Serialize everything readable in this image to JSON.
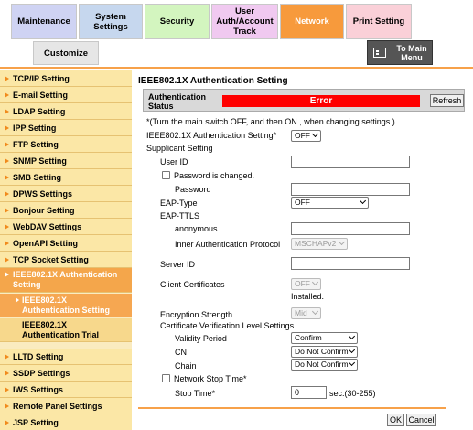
{
  "tabs": {
    "maintenance": "Maintenance",
    "system_settings": "System Settings",
    "security": "Security",
    "user_auth": "User Auth/Account Track",
    "network": "Network",
    "print_setting": "Print Setting",
    "customize": "Customize",
    "to_main_menu": "To Main Menu"
  },
  "sidebar": {
    "items": [
      "TCP/IP Setting",
      "E-mail Setting",
      "LDAP Setting",
      "IPP Setting",
      "FTP Setting",
      "SNMP Setting",
      "SMB Setting",
      "DPWS Settings",
      "Bonjour Setting",
      "WebDAV Settings",
      "OpenAPI Setting",
      "TCP Socket Setting",
      "IEEE802.1X Authentication Setting",
      "LLTD Setting",
      "SSDP Settings",
      "IWS Settings",
      "Remote Panel Settings",
      "JSP Setting"
    ],
    "subitems": [
      "IEEE802.1X Authentication Setting",
      "IEEE802.1X Authentication Trial"
    ]
  },
  "main": {
    "title": "IEEE802.1X Authentication Setting",
    "status_label": "Authentication Status",
    "status_value": "Error",
    "refresh": "Refresh",
    "note": "*(Turn the main switch OFF, and then ON , when changing settings.)",
    "ieee_label": "IEEE802.1X Authentication Setting*",
    "ieee_value": "OFF",
    "supplicant": "Supplicant Setting",
    "user_id": "User ID",
    "password_changed": "Password is changed.",
    "password": "Password",
    "eap_type": "EAP-Type",
    "eap_type_value": "OFF",
    "eap_ttls": "EAP-TTLS",
    "anonymous": "anonymous",
    "inner_auth": "Inner Authentication Protocol",
    "inner_auth_value": "MSCHAPv2",
    "server_id": "Server ID",
    "client_certs": "Client Certificates",
    "client_certs_value": "OFF",
    "installed": "Installed.",
    "encryption": "Encryption Strength",
    "encryption_value": "Mid",
    "cert_verify": "Certificate Verification Level Settings",
    "validity": "Validity Period",
    "validity_value": "Confirm",
    "cn": "CN",
    "cn_value": "Do Not Confirm",
    "chain": "Chain",
    "chain_value": "Do Not Confirm",
    "network_stop": "Network Stop Time*",
    "stop_time": "Stop Time*",
    "stop_time_value": "0",
    "stop_time_unit": "sec.(30-255)",
    "ok": "OK",
    "cancel": "Cancel"
  },
  "colors": {
    "network_tab": "#f79a3c",
    "sidebar_bg": "#fbe7a6",
    "error": "#ff0000"
  }
}
